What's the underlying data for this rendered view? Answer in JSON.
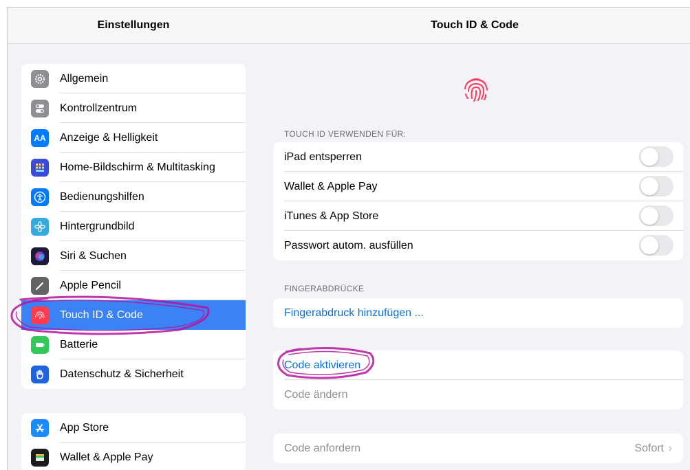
{
  "sidebar": {
    "title": "Einstellungen",
    "group1": [
      {
        "label": "Allgemein",
        "icon": "gear-icon",
        "color": "#8e8e93"
      },
      {
        "label": "Kontrollzentrum",
        "icon": "switches-icon",
        "color": "#8e8e93"
      },
      {
        "label": "Anzeige & Helligkeit",
        "icon": "text-size-icon",
        "color": "#007aff"
      },
      {
        "label": "Home-Bildschirm & Multitasking",
        "icon": "grid-icon",
        "color": "#3a4bd8"
      },
      {
        "label": "Bedienungshilfen",
        "icon": "accessibility-icon",
        "color": "#007aff"
      },
      {
        "label": "Hintergrundbild",
        "icon": "flower-icon",
        "color": "#35aadc"
      },
      {
        "label": "Siri & Suchen",
        "icon": "siri-icon",
        "color": "#1c1c3a"
      },
      {
        "label": "Apple Pencil",
        "icon": "pencil-icon",
        "color": "#636366"
      },
      {
        "label": "Touch ID & Code",
        "icon": "fingerprint-icon",
        "color": "#ff3b4e",
        "selected": true
      },
      {
        "label": "Batterie",
        "icon": "battery-icon",
        "color": "#34c759"
      },
      {
        "label": "Datenschutz & Sicherheit",
        "icon": "hand-icon",
        "color": "#1e63e0"
      }
    ],
    "group2": [
      {
        "label": "App Store",
        "icon": "app-store-icon",
        "color": "#1a8cff"
      },
      {
        "label": "Wallet & Apple Pay",
        "icon": "wallet-icon",
        "color": "#1c1c1e"
      }
    ]
  },
  "detail": {
    "title": "Touch ID & Code",
    "section_touchid": "TOUCH ID VERWENDEN FÜR:",
    "toggles": [
      {
        "label": "iPad entsperren",
        "on": false
      },
      {
        "label": "Wallet & Apple Pay",
        "on": false
      },
      {
        "label": "iTunes & App Store",
        "on": false
      },
      {
        "label": "Passwort autom. ausfüllen",
        "on": false
      }
    ],
    "section_fingerprints": "FINGERABDRÜCKE",
    "add_fingerprint": "Fingerabdruck hinzufügen ...",
    "code_activate": "Code aktivieren",
    "code_change": "Code ändern",
    "code_require": "Code anfordern",
    "code_require_value": "Sofort"
  },
  "colors": {
    "accent": "#0a6fd8",
    "selected": "#3b82f6",
    "annotation": "#b5179e"
  }
}
